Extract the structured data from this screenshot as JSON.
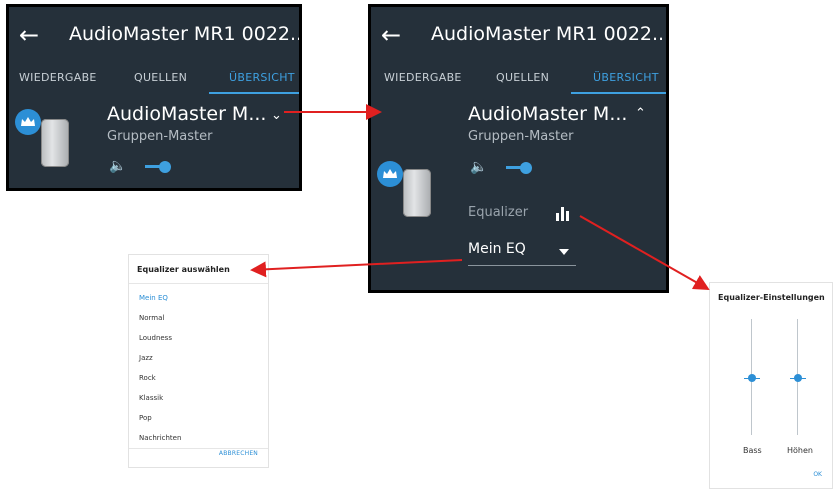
{
  "colors": {
    "panel_bg": "#25303a",
    "accent": "#3ea0e0",
    "annotation_arrow": "#e02020"
  },
  "app": {
    "title": "AudioMaster MR1 0022...",
    "tabs": [
      "WIEDERGABE",
      "QUELLEN",
      "ÜBERSICHT"
    ],
    "active_tab": "ÜBERSICHT"
  },
  "device": {
    "name": "AudioMaster M...",
    "role": "Gruppen-Master",
    "volume_level": 0.2
  },
  "equalizer_section": {
    "label": "Equalizer",
    "current": "Mein EQ"
  },
  "select_dialog": {
    "title": "Equalizer auswählen",
    "options": [
      "Mein EQ",
      "Normal",
      "Loudness",
      "Jazz",
      "Rock",
      "Klassik",
      "Pop",
      "Nachrichten"
    ],
    "selected": "Mein EQ",
    "cancel_label": "ABBRECHEN"
  },
  "settings_dialog": {
    "title": "Equalizer-Einstellungen",
    "sliders": [
      {
        "label": "Bass",
        "level": 0.5
      },
      {
        "label": "Höhen",
        "level": 0.5
      }
    ],
    "ok_label": "OK"
  },
  "icons": [
    "back-arrow-icon",
    "chevron-down-icon",
    "chevron-up-icon",
    "crown-icon",
    "volume-icon",
    "equalizer-bars-icon",
    "dropdown-caret-icon"
  ]
}
